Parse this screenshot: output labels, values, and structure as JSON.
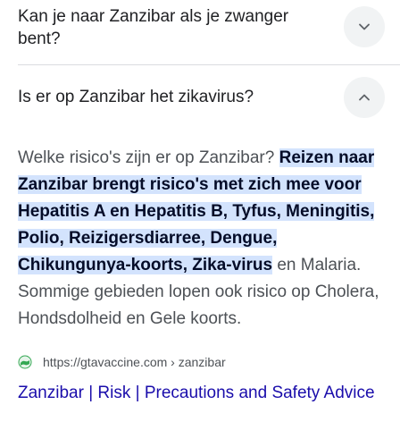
{
  "faq": [
    {
      "question": "Kan je naar Zanzibar als je zwanger bent?",
      "expanded": false,
      "icon": "chevron-down-icon"
    },
    {
      "question": "Is er op Zanzibar het zikavirus?",
      "expanded": true,
      "icon": "chevron-up-icon"
    }
  ],
  "answer": {
    "intro": "Welke risico's zijn er op Zanzibar? ",
    "highlight": "Reizen naar Zanzibar brengt risico's met zich mee voor Hepatitis A en Hepatitis B, Tyfus, Meningitis, Polio, Reizigersdiarree, Dengue, Chikungunya-koorts, Zika-virus",
    "rest": " en Malaria. Sommige gebieden lopen ook risico op Cholera, Hondsdolheid en Gele koorts."
  },
  "source": {
    "url": "https://gtavaccine.com › zanzibar",
    "favicon": "globe-favicon-icon",
    "title": "Zanzibar | Risk | Precautions and Safety Advice"
  },
  "colors": {
    "highlight": "#d3e3fd",
    "link": "#1a0dab",
    "favicon": "#34a853"
  }
}
